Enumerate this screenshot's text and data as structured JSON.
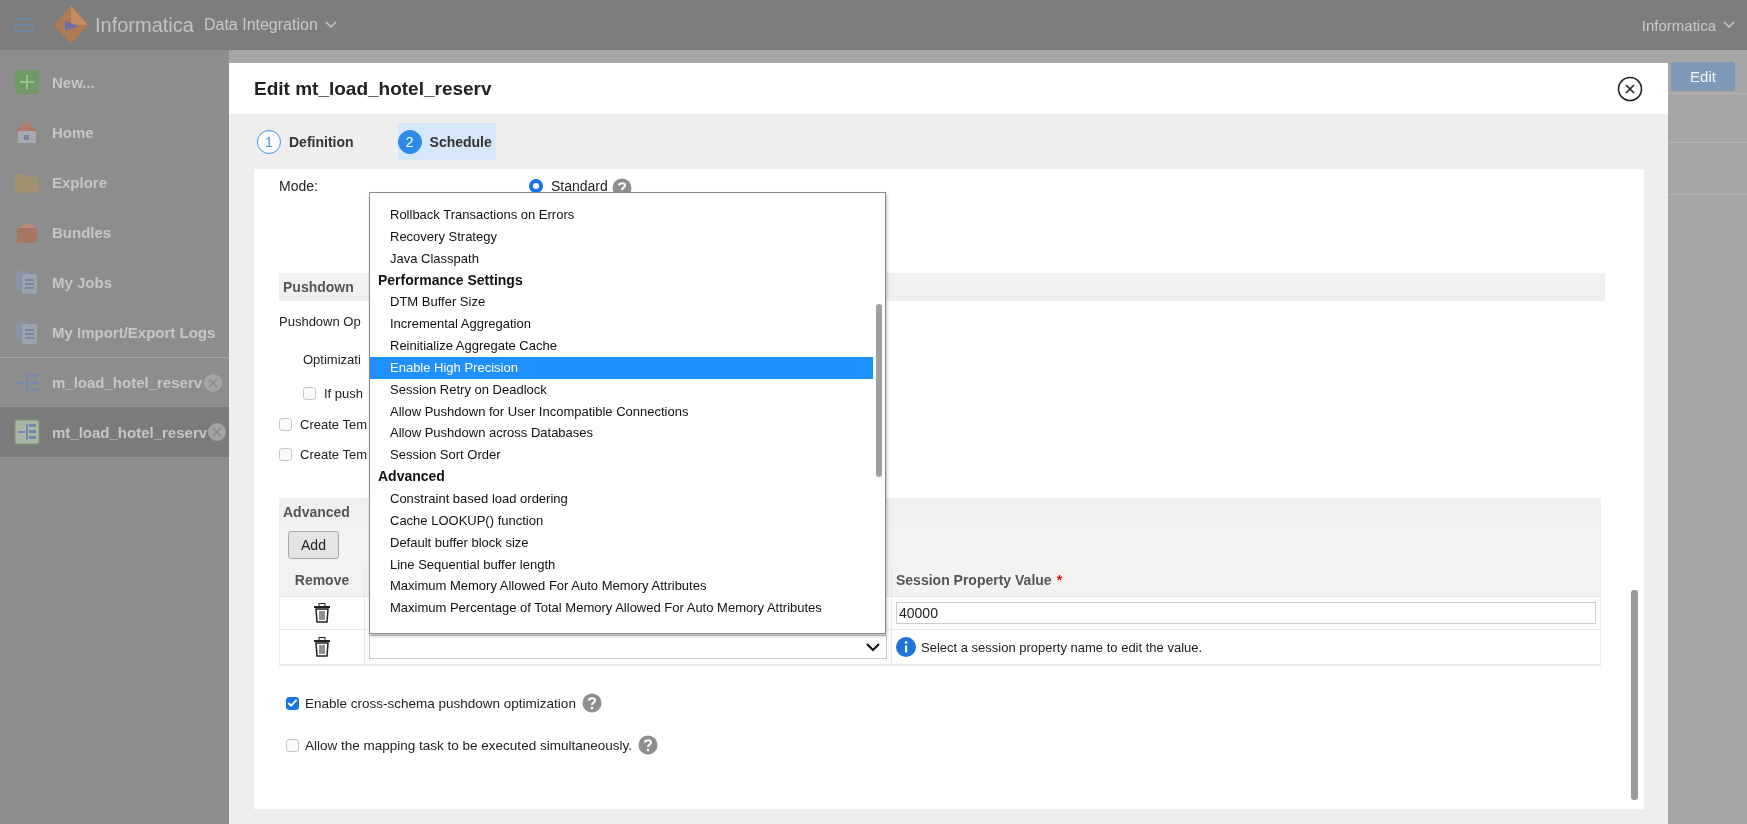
{
  "topbar": {
    "product": "Informatica",
    "service": "Data Integration",
    "user": "Informatica"
  },
  "sidebar": {
    "items": [
      {
        "kind": "new",
        "label": "New...",
        "selected": false
      },
      {
        "kind": "home",
        "label": "Home",
        "selected": false
      },
      {
        "kind": "explore",
        "label": "Explore",
        "selected": false
      },
      {
        "kind": "bundles",
        "label": "Bundles",
        "selected": false
      },
      {
        "kind": "jobs",
        "label": "My Jobs",
        "selected": false
      },
      {
        "kind": "logs",
        "label": "My Import/Export Logs",
        "selected": false
      },
      {
        "kind": "mapping",
        "label": "m_load_hotel_reserv",
        "selected": false
      },
      {
        "kind": "task",
        "label": "mt_load_hotel_reserv",
        "selected": true
      }
    ]
  },
  "background": {
    "button": "Edit"
  },
  "dialog": {
    "title": "Edit mt_load_hotel_reserv",
    "steps": [
      {
        "number": "1",
        "label": "Definition",
        "selected": false
      },
      {
        "number": "2",
        "label": "Schedule",
        "selected": true
      }
    ],
    "mode": {
      "label": "Mode:",
      "option": "Standard",
      "selected": true
    },
    "pushdown": {
      "heading": "Pushdown",
      "option_label": "Pushdown Op",
      "optimization_label": "Optimizati",
      "fallback": {
        "label": "If push",
        "checked": false
      },
      "temp_options": [
        {
          "label": "Create Tem",
          "checked": false
        },
        {
          "label": "Create Tem",
          "checked": false
        }
      ]
    },
    "advanced": {
      "heading": "Advanced",
      "add_button": "Add",
      "columns": [
        {
          "label": "Remove"
        },
        {
          "label": "Session Property Value",
          "mark": "*"
        }
      ],
      "rows": [
        {
          "kind": "value",
          "value": "40000"
        },
        {
          "kind": "select",
          "hint": "Select a session property name to edit the value."
        }
      ]
    },
    "options": [
      {
        "label": "Enable cross-schema pushdown optimization",
        "checked": true
      },
      {
        "label": "Allow the mapping task to be executed simultaneously.",
        "checked": false
      }
    ],
    "dropdown": {
      "groups": [
        {
          "options": [
            {
              "label": "Rollback Transactions on Errors",
              "selected": false
            },
            {
              "label": "Recovery Strategy",
              "selected": false
            },
            {
              "label": "Java Classpath",
              "selected": false
            }
          ]
        },
        {
          "title": "Performance Settings",
          "options": [
            {
              "label": "DTM Buffer Size",
              "selected": false
            },
            {
              "label": "Incremental Aggregation",
              "selected": false
            },
            {
              "label": "Reinitialize Aggregate Cache",
              "selected": false
            },
            {
              "label": "Enable High Precision",
              "selected": true
            },
            {
              "label": "Session Retry on Deadlock",
              "selected": false
            },
            {
              "label": "Allow Pushdown for User Incompatible Connections",
              "selected": false
            },
            {
              "label": "Allow Pushdown across Databases",
              "selected": false
            },
            {
              "label": "Session Sort Order",
              "selected": false
            }
          ]
        },
        {
          "title": "Advanced",
          "options": [
            {
              "label": "Constraint based load ordering",
              "selected": false
            },
            {
              "label": "Cache LOOKUP() function",
              "selected": false
            },
            {
              "label": "Default buffer block size",
              "selected": false
            },
            {
              "label": "Line Sequential buffer length",
              "selected": false
            },
            {
              "label": "Maximum Memory Allowed For Auto Memory Attributes",
              "selected": false
            },
            {
              "label": "Maximum Percentage of Total Memory Allowed For Auto Memory Attributes",
              "selected": false
            }
          ]
        }
      ]
    }
  }
}
